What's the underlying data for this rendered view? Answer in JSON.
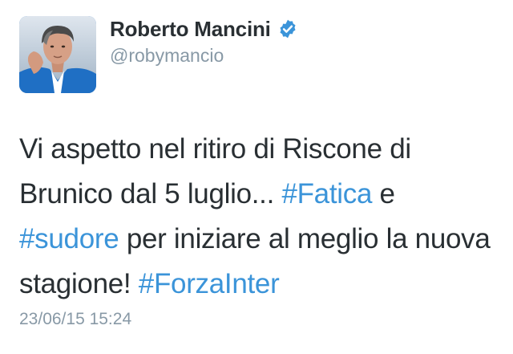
{
  "tweet": {
    "author": {
      "name": "Roberto Mancini",
      "handle": "@robymancio",
      "verified": true
    },
    "text_parts": [
      "Vi aspetto nel ritiro di Riscone di Brunico dal 5 luglio... ",
      "#Fatica",
      " e ",
      "#sudore",
      " per iniziare al meglio la nuova stagione! ",
      "#ForzaInter"
    ],
    "timestamp": "23/06/15 15:24"
  },
  "colors": {
    "text": "#292f33",
    "hashtag": "#3b94d9",
    "muted": "#8899a6",
    "verified_badge": "#3b94d9"
  }
}
